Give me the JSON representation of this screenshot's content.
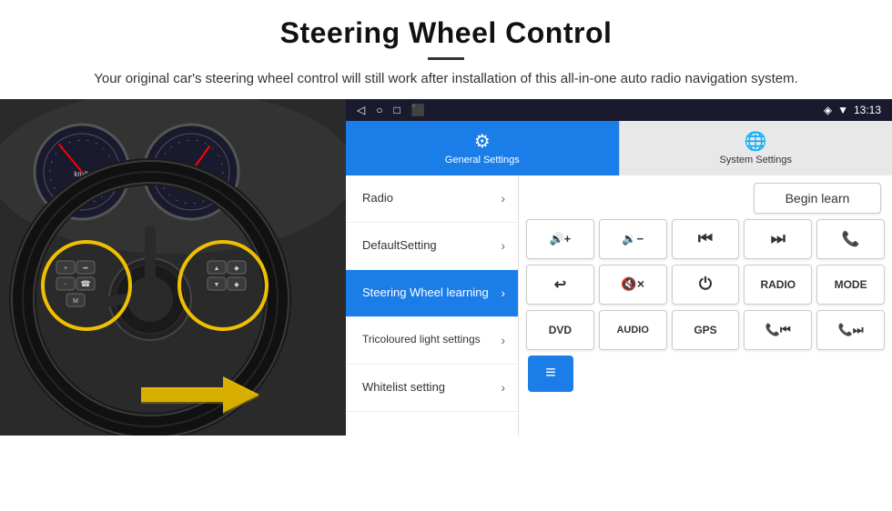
{
  "header": {
    "title": "Steering Wheel Control",
    "divider": true,
    "subtitle": "Your original car's steering wheel control will still work after installation of this all-in-one auto radio navigation system."
  },
  "status_bar": {
    "time": "13:13",
    "icons": [
      "◁",
      "○",
      "□",
      "⬛"
    ]
  },
  "tabs": [
    {
      "id": "general",
      "label": "General Settings",
      "active": true
    },
    {
      "id": "system",
      "label": "System Settings",
      "active": false
    }
  ],
  "menu": {
    "items": [
      {
        "label": "Radio",
        "active": false
      },
      {
        "label": "DefaultSetting",
        "active": false
      },
      {
        "label": "Steering Wheel learning",
        "active": true
      },
      {
        "label": "Tricoloured light settings",
        "active": false
      },
      {
        "label": "Whitelist setting",
        "active": false
      }
    ]
  },
  "controls": {
    "begin_learn_label": "Begin learn",
    "row1": [
      {
        "label": "🔊+",
        "id": "vol-up"
      },
      {
        "label": "🔉-",
        "id": "vol-down"
      },
      {
        "label": "⏮",
        "id": "prev-track"
      },
      {
        "label": "⏭",
        "id": "next-track"
      },
      {
        "label": "📞",
        "id": "phone"
      }
    ],
    "row2": [
      {
        "label": "↩",
        "id": "hang-up"
      },
      {
        "label": "🔇×",
        "id": "mute"
      },
      {
        "label": "⏻",
        "id": "power"
      },
      {
        "label": "RADIO",
        "id": "radio"
      },
      {
        "label": "MODE",
        "id": "mode"
      }
    ],
    "row3": [
      {
        "label": "DVD",
        "id": "dvd"
      },
      {
        "label": "AUDIO",
        "id": "audio"
      },
      {
        "label": "GPS",
        "id": "gps"
      },
      {
        "label": "📻⏮",
        "id": "seek-back"
      },
      {
        "label": "📻⏭",
        "id": "seek-fwd"
      }
    ],
    "whitelist_icon": "≡"
  },
  "colors": {
    "accent_blue": "#1a7de8",
    "active_menu": "#1a7de8",
    "status_bar_bg": "#1a1a2e",
    "white": "#ffffff",
    "border": "#cccccc"
  }
}
